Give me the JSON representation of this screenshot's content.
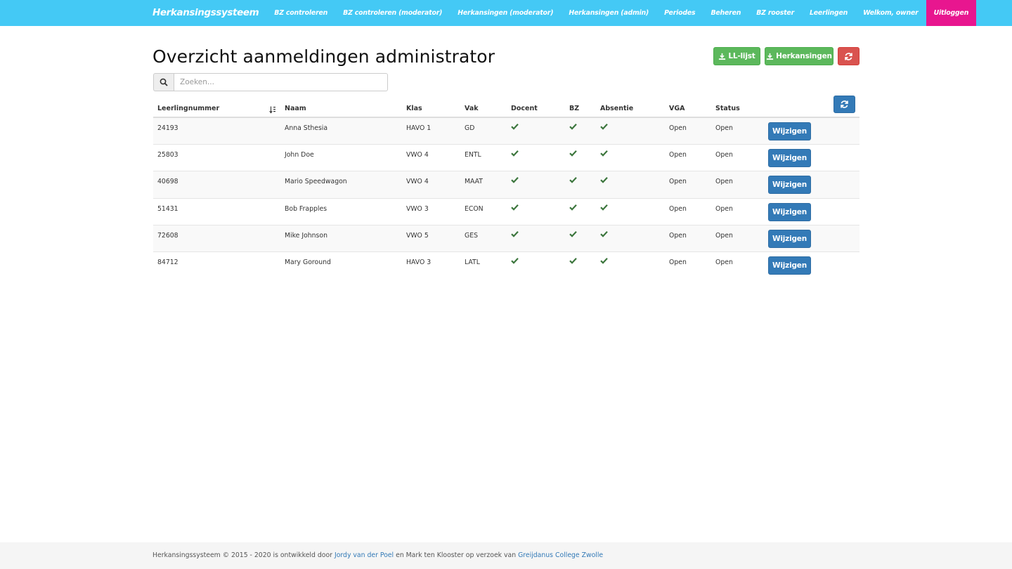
{
  "navbar": {
    "brand": "Herkansingssysteem",
    "items": [
      {
        "label": "BZ controleren"
      },
      {
        "label": "BZ controleren (moderator)"
      },
      {
        "label": "Herkansingen (moderator)"
      },
      {
        "label": "Herkansingen (admin)"
      },
      {
        "label": "Periodes"
      },
      {
        "label": "Beheren"
      },
      {
        "label": "BZ rooster"
      },
      {
        "label": "Leerlingen"
      },
      {
        "label": "Welkom, owner"
      }
    ],
    "logout_label": "Uitloggen"
  },
  "page": {
    "title": "Overzicht aanmeldingen administrator"
  },
  "actions": {
    "ll_lijst_label": "LL-lijst",
    "herkansingen_label": "Herkansingen",
    "refresh_icon": "refresh-icon"
  },
  "search": {
    "placeholder": "Zoeken...",
    "value": ""
  },
  "table": {
    "columns": {
      "leerlingnummer": "Leerlingnummer",
      "naam": "Naam",
      "klas": "Klas",
      "vak": "Vak",
      "docent": "Docent",
      "bz": "BZ",
      "absentie": "Absentie",
      "vga": "VGA",
      "status": "Status"
    },
    "sort_icon": "sort-ascending-icon",
    "rows": [
      {
        "leerlingnummer": "24193",
        "naam": "Anna Sthesia",
        "klas": "HAVO 1",
        "vak": "GD",
        "docent": true,
        "bz": true,
        "absentie": true,
        "vga": "Open",
        "status": "Open",
        "action": "Wijzigen"
      },
      {
        "leerlingnummer": "25803",
        "naam": "John Doe",
        "klas": "VWO 4",
        "vak": "ENTL",
        "docent": true,
        "bz": true,
        "absentie": true,
        "vga": "Open",
        "status": "Open",
        "action": "Wijzigen"
      },
      {
        "leerlingnummer": "40698",
        "naam": "Mario Speedwagon",
        "klas": "VWO 4",
        "vak": "MAAT",
        "docent": true,
        "bz": true,
        "absentie": true,
        "vga": "Open",
        "status": "Open",
        "action": "Wijzigen"
      },
      {
        "leerlingnummer": "51431",
        "naam": "Bob Frapples",
        "klas": "VWO 3",
        "vak": "ECON",
        "docent": true,
        "bz": true,
        "absentie": true,
        "vga": "Open",
        "status": "Open",
        "action": "Wijzigen"
      },
      {
        "leerlingnummer": "72608",
        "naam": "Mike Johnson",
        "klas": "VWO 5",
        "vak": "GES",
        "docent": true,
        "bz": true,
        "absentie": true,
        "vga": "Open",
        "status": "Open",
        "action": "Wijzigen"
      },
      {
        "leerlingnummer": "84712",
        "naam": "Mary Goround",
        "klas": "HAVO 3",
        "vak": "LATL",
        "docent": true,
        "bz": true,
        "absentie": true,
        "vga": "Open",
        "status": "Open",
        "action": "Wijzigen"
      }
    ]
  },
  "footer": {
    "text_1": "Herkansingssysteem © 2015 - 2020 is ontwikkeld door",
    "link_1": "Jordy van der Poel",
    "text_2": "en Mark ten Klooster op verzoek van",
    "link_2": "Greijdanus College Zwolle"
  },
  "colors": {
    "navbar": "#44c9f5",
    "logout": "#e8168f",
    "success": "#5cb85c",
    "danger": "#d9534f",
    "primary": "#337ab7",
    "check": "#3c763d"
  }
}
